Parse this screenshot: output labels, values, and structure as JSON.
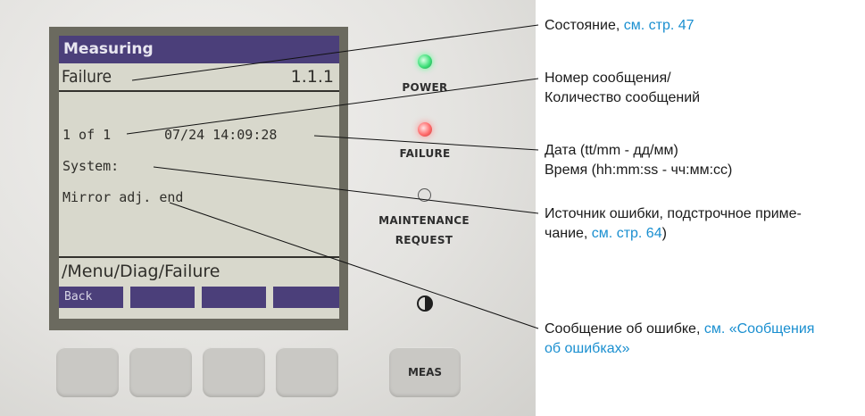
{
  "display": {
    "header": "Measuring",
    "status": "Failure",
    "code": "1.1.1",
    "counter": "1 of 1",
    "datetime": "07/24 14:09:28",
    "source": "System:",
    "message": "Mirror adj. end",
    "path": "/Menu/Diag/Failure",
    "softkey1": "Back"
  },
  "indicators": {
    "power": "POWER",
    "failure": "FAILURE",
    "maintenance_line1": "MAINTENANCE",
    "maintenance_line2": "REQUEST"
  },
  "buttons": {
    "contrast_icon": "contrast-icon",
    "meas": "MEAS"
  },
  "callouts": {
    "state_text": "Состояние, ",
    "state_link": "см. стр. 47",
    "number_line1": "Номер сообщения/",
    "number_line2": "Количество сообщений",
    "date_line1": "Дата (tt/mm - дд/мм)",
    "date_line2": "Время (hh:mm:ss - чч:мм:сс)",
    "source_line1": "Источник ошибки, подстрочное приме-",
    "source_line2_text": "чание, ",
    "source_line2_link": "см. стр. 64",
    "source_line2_end": ")",
    "message_text": "Сообщение об ошибке, ",
    "message_link1": "см. «Сообщения",
    "message_link2": "об ошибках»"
  },
  "colors": {
    "lcd_background": "#d8d8cc",
    "lcd_header": "#4b3f7a",
    "link": "#1a8fd0",
    "led_power": "#3fe07a",
    "led_failure": "#ff6b6b"
  }
}
